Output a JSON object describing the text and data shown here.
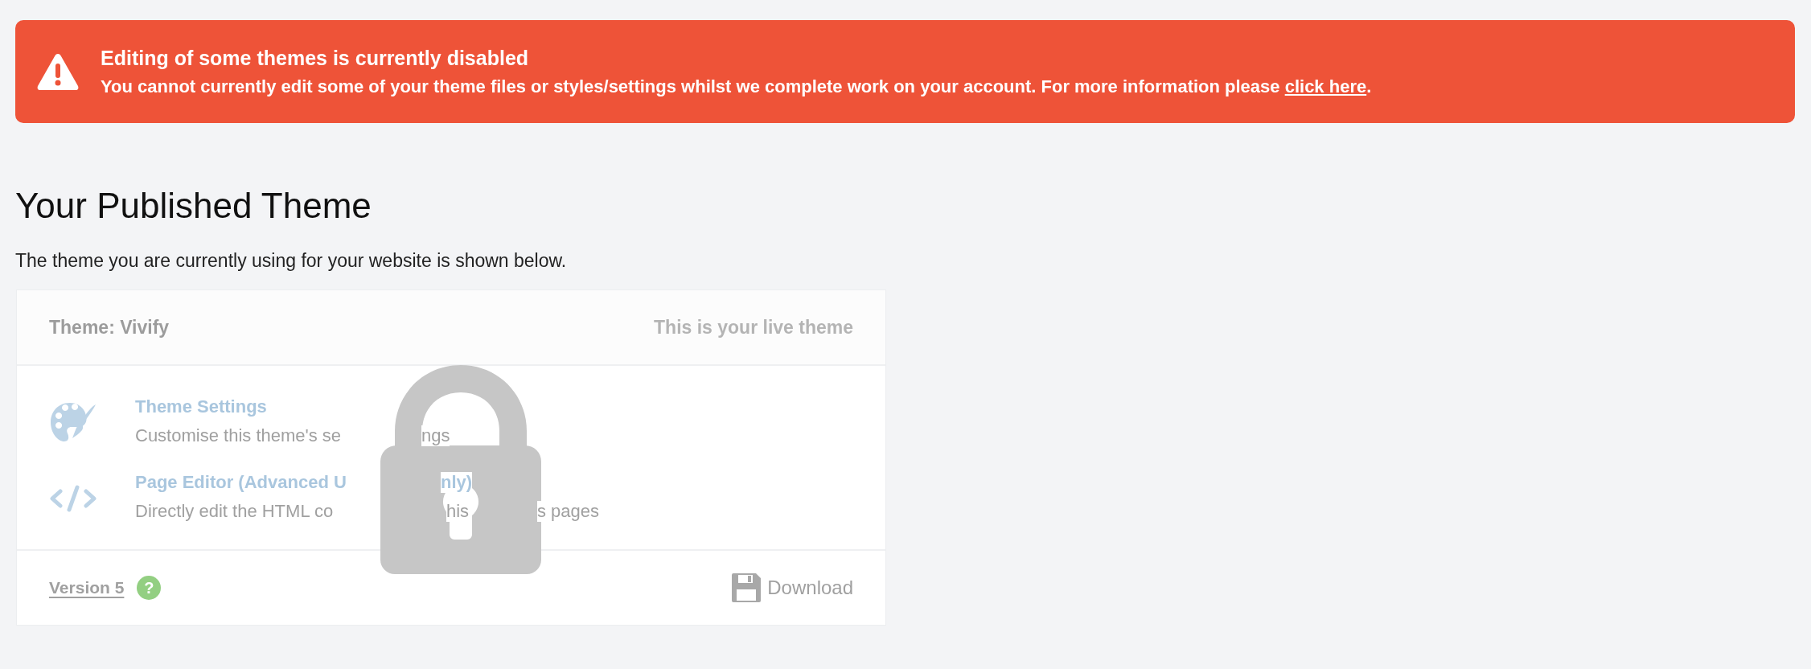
{
  "alert": {
    "title": "Editing of some themes is currently disabled",
    "message": "You cannot currently edit some of your theme files or styles/settings whilst we complete work on your account. For more information please ",
    "link": "click here",
    "end": "."
  },
  "heading": "Your Published Theme",
  "intro": "The theme you are currently using for your website is shown below.",
  "card": {
    "theme_name": "Theme: Vivify",
    "status": "This is your live theme",
    "locked": true,
    "items": [
      {
        "kind": "palette",
        "title_parts": [
          "Theme Settings"
        ],
        "description_parts": [
          "Customise this theme's se",
          "ngs"
        ]
      },
      {
        "kind": "code",
        "title_parts": [
          "Page Editor (Advanced U",
          "nly)"
        ],
        "description_parts": [
          "Directly edit the HTML co",
          "his",
          "s pages"
        ]
      }
    ],
    "version": "Version 5",
    "help": "?",
    "download": "Download"
  }
}
